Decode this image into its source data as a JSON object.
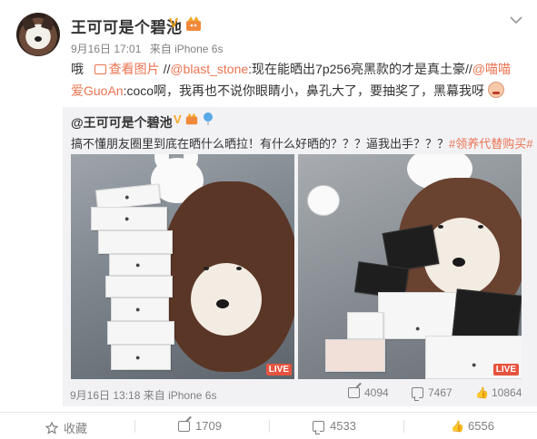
{
  "author": {
    "name": "王可可是个碧池",
    "verified_mark": "V",
    "time": "9月16日 17:01",
    "source": "来自 iPhone 6s"
  },
  "post": {
    "prefix": "哦",
    "view_image_label": "查看图片",
    "sep1": "//",
    "mention1": "@blast_stone",
    "text1": ":现在能晒出7p256亮黑款的才是真土豪//",
    "mention2": "@喵喵爱GuoAn",
    "text2": ":coco啊，我再也不说你眼睛小，鼻孔大了，要抽奖了，黑幕我呀"
  },
  "repost": {
    "user": "@王可可是个碧池",
    "verified_mark": "V",
    "text": "搞不懂朋友圈里到底在晒什么晒拉！有什么好晒的？？？逼我出手？？？",
    "hashtag": "#领养代替购买#",
    "live_label_1": "LIVE",
    "live_label_2": "LIVE",
    "time": "9月16日 13:18",
    "source": "来自 iPhone 6s",
    "shares": "4094",
    "comments": "7467",
    "likes": "10864"
  },
  "actions": {
    "favorite_label": "收藏",
    "share_count": "1709",
    "comment_count": "4533",
    "like_count": "6556"
  },
  "colors": {
    "accent": "#eb7350",
    "verified": "#f5a623",
    "live": "#e6533e"
  }
}
